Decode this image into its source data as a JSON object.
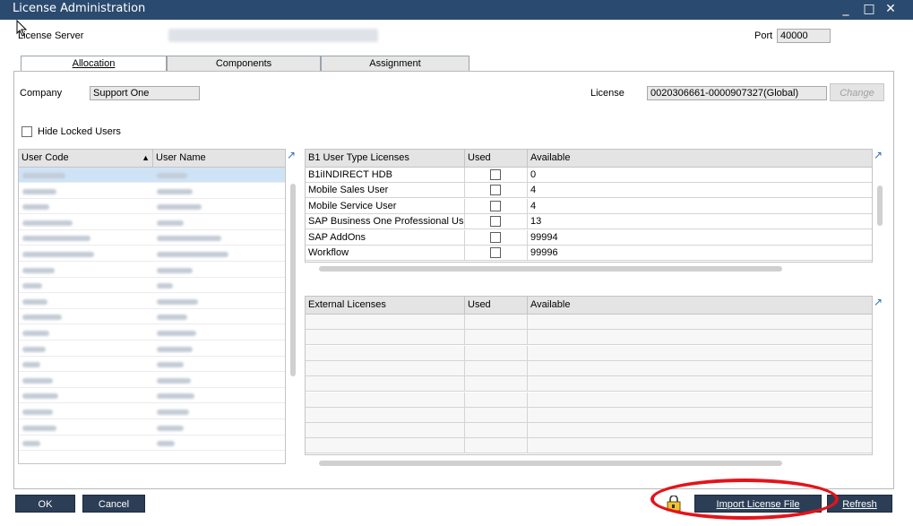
{
  "window": {
    "title": "License Administration",
    "minimize_glyph": "_",
    "maximize_glyph": "□",
    "close_glyph": "✕"
  },
  "header": {
    "license_server_label": "License Server",
    "port_label": "Port",
    "port_value": "40000"
  },
  "tabs": [
    {
      "label": "Allocation",
      "active": true
    },
    {
      "label": "Components",
      "active": false
    },
    {
      "label": "Assignment",
      "active": false
    }
  ],
  "allocation": {
    "company_label": "Company",
    "company_value": "Support One",
    "license_label": "License",
    "license_value": "0020306661-0000907327(Global)",
    "change_button": "Change",
    "hide_locked_label": "Hide Locked Users",
    "users_table": {
      "columns": [
        "User Code",
        "User Name"
      ],
      "sort_indicator": "▲"
    },
    "b1_table": {
      "columns": [
        "B1 User Type Licenses",
        "Used",
        "Available"
      ],
      "rows": [
        {
          "name": "B1iINDIRECT HDB",
          "available": "0"
        },
        {
          "name": "Mobile Sales User",
          "available": "4"
        },
        {
          "name": "Mobile Service User",
          "available": "4"
        },
        {
          "name": "SAP Business One Professional User",
          "available": "13"
        },
        {
          "name": "SAP AddOns",
          "available": "99994"
        },
        {
          "name": "Workflow",
          "available": "99996"
        }
      ]
    },
    "external_table": {
      "columns": [
        "External Licenses",
        "Used",
        "Available"
      ]
    }
  },
  "footer": {
    "ok_button": "OK",
    "cancel_button": "Cancel",
    "import_button": "Import License File",
    "refresh_button": "Refresh"
  },
  "colors": {
    "titlebar": "#2b4a6f",
    "button": "#2c3e56",
    "highlight_ring": "#e4131b"
  }
}
